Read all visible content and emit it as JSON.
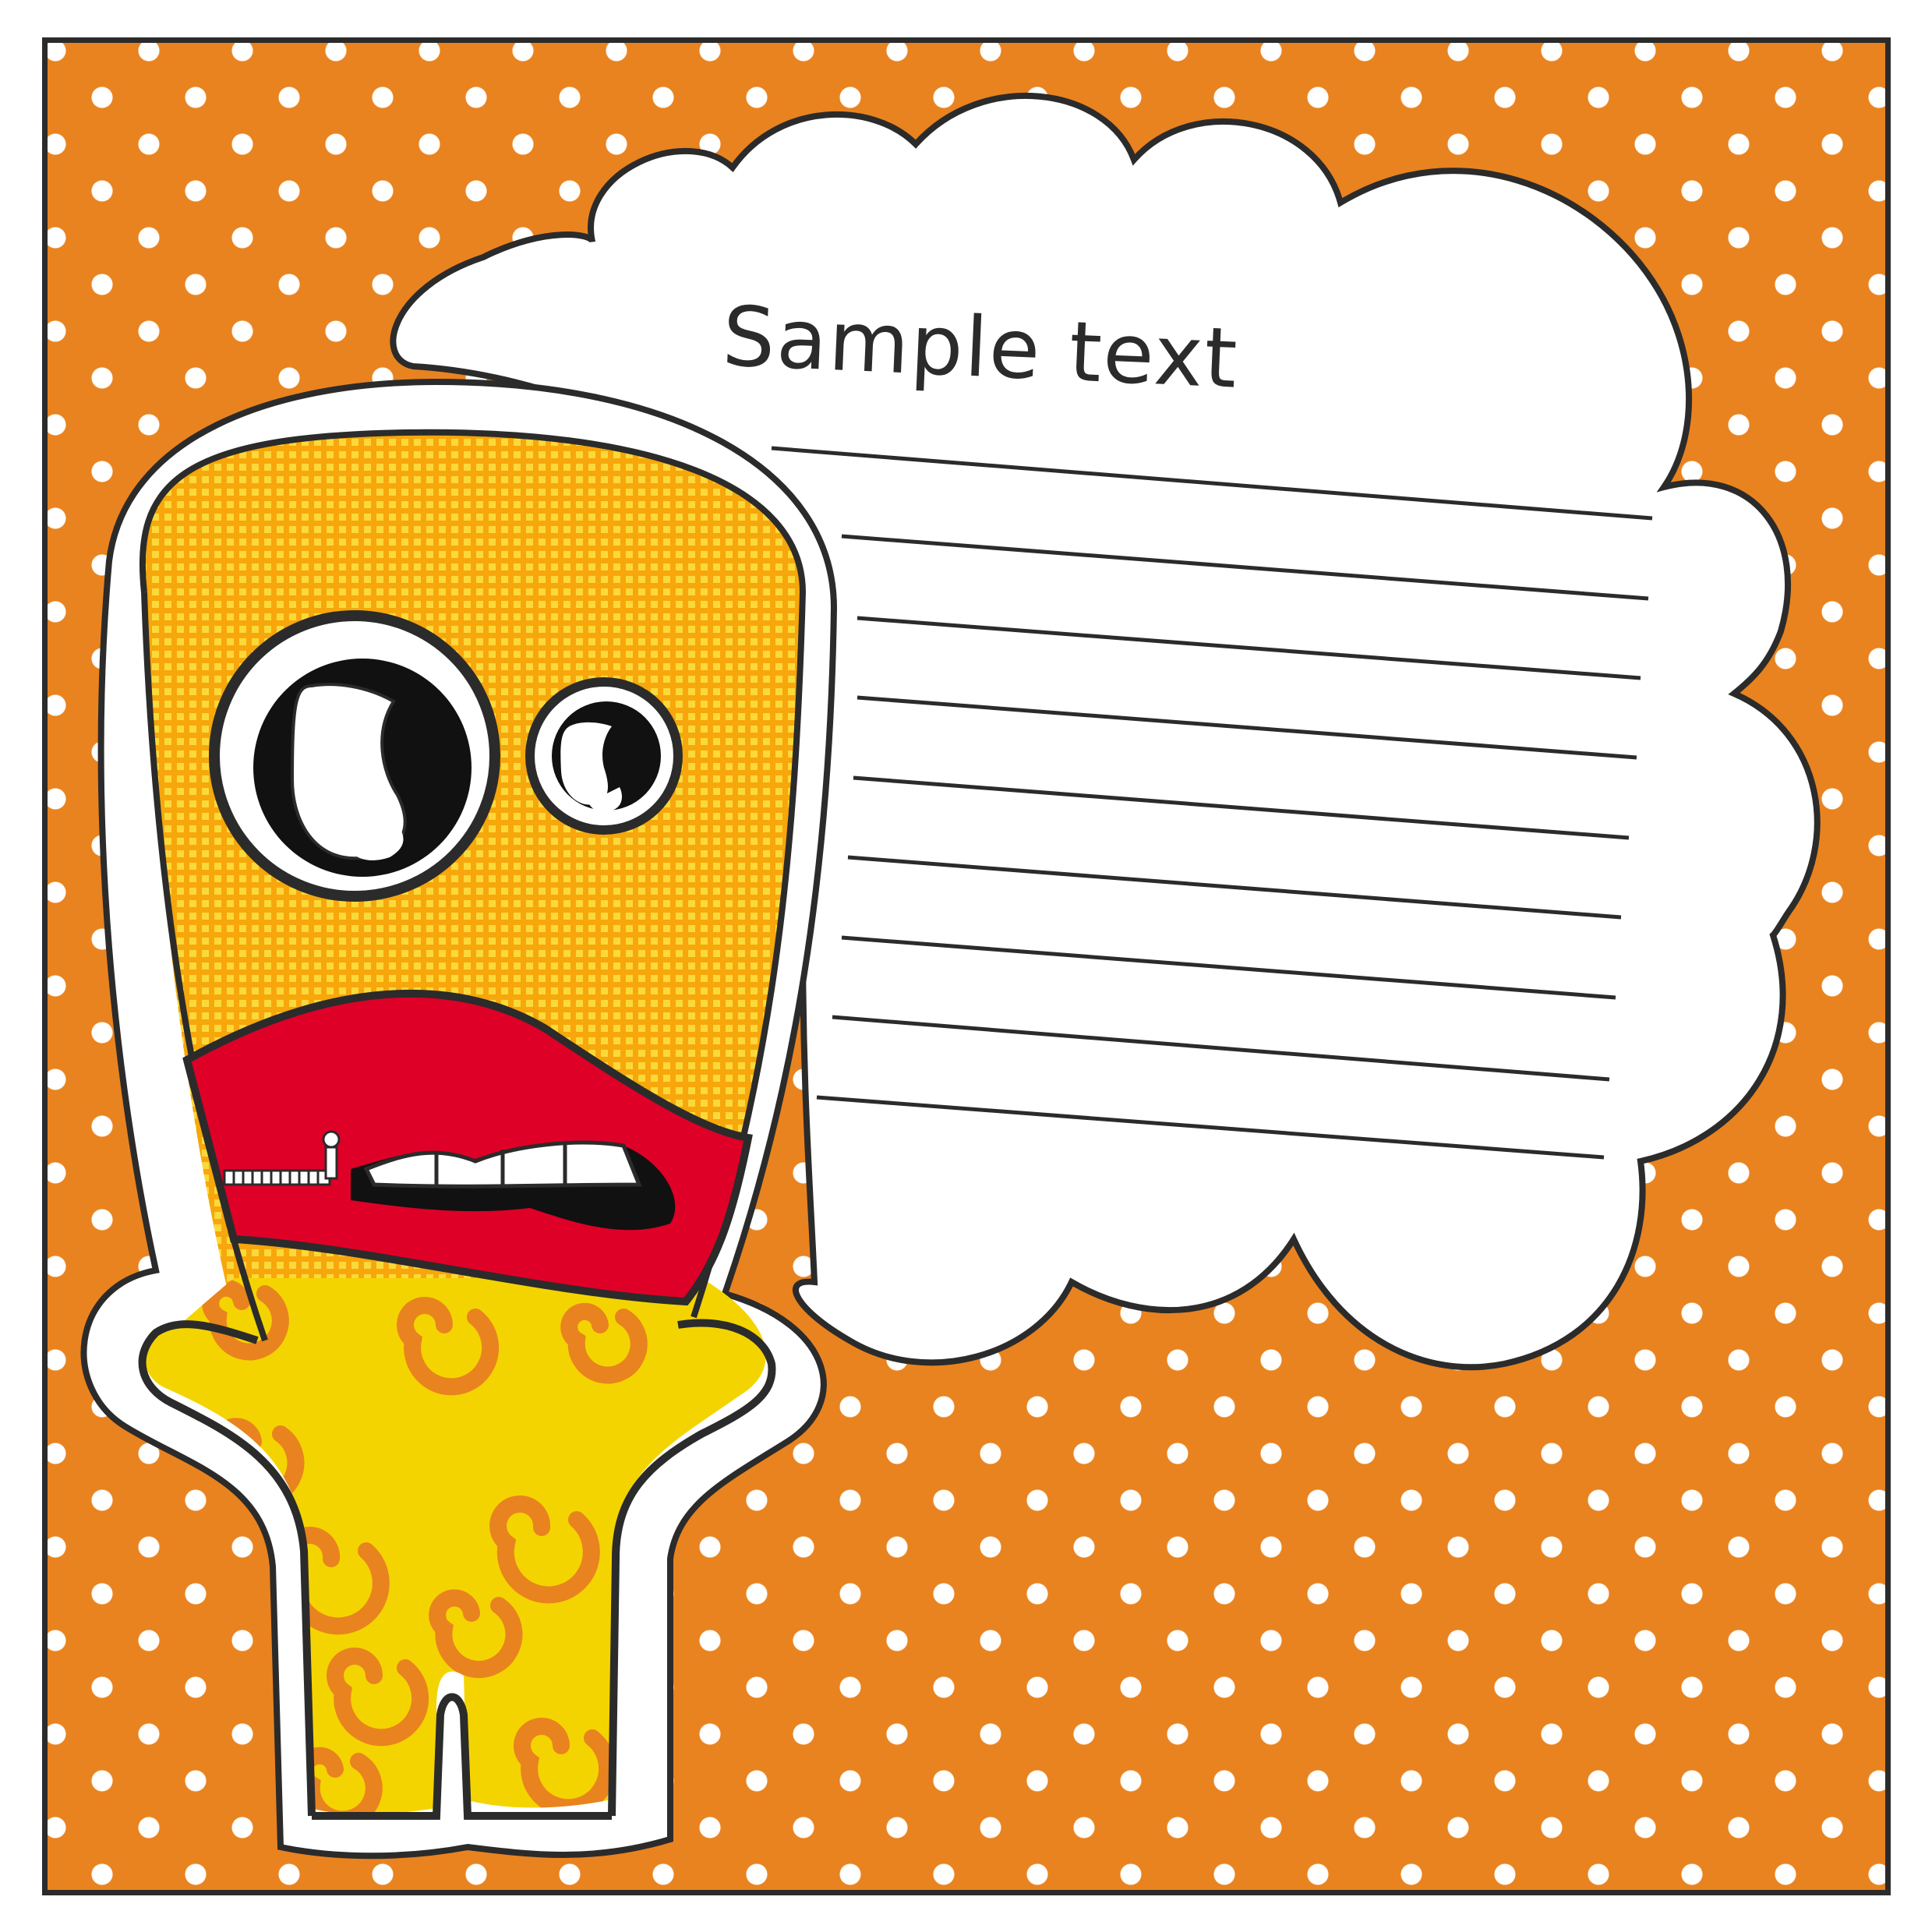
{
  "bubble": {
    "heading": "Sample text",
    "ruled_line_count": 9
  },
  "colors": {
    "background": "#e9831f",
    "dots": "#ffffff",
    "outline": "#2b2b2b",
    "mouth": "#df0027",
    "body": "#f4d400",
    "spirals": "#e9831f",
    "face_pattern": "#f2b600"
  },
  "character": {
    "icon": "monster-icon"
  }
}
